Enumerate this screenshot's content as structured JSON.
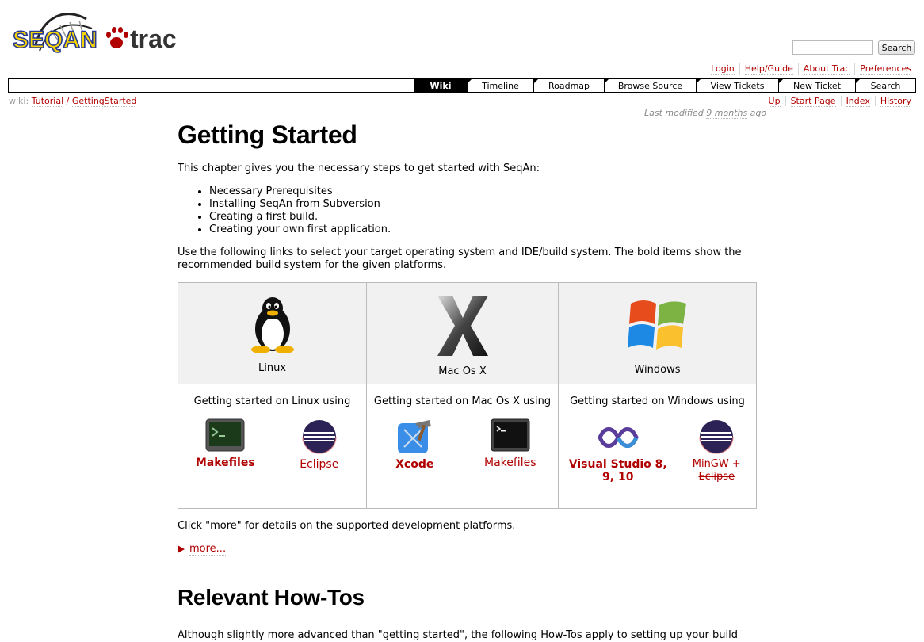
{
  "logo": {
    "project_text": "SEQAN",
    "trac_text": "trac",
    "icon": "paw-icon"
  },
  "search": {
    "button_label": "Search",
    "placeholder": ""
  },
  "metanav": [
    "Login",
    "Help/Guide",
    "About Trac",
    "Preferences"
  ],
  "mainnav": {
    "tabs": [
      {
        "label": "Wiki",
        "active": true
      },
      {
        "label": "Timeline",
        "active": false
      },
      {
        "label": "Roadmap",
        "active": false
      },
      {
        "label": "Browse Source",
        "active": false
      },
      {
        "label": "View Tickets",
        "active": false
      },
      {
        "label": "New Ticket",
        "active": false
      },
      {
        "label": "Search",
        "active": false
      }
    ]
  },
  "breadcrumb": {
    "prefix": "wiki:",
    "items": [
      "Tutorial",
      "/",
      "GettingStarted"
    ]
  },
  "ctxnav": [
    "Up",
    "Start Page",
    "Index",
    "History"
  ],
  "lastmod": {
    "prefix": "Last modified ",
    "age": "9 months",
    "suffix": " ago"
  },
  "page": {
    "title": "Getting Started",
    "intro": "This chapter gives you the necessary steps to get started with SeqAn:",
    "steps": [
      "Necessary Prerequisites",
      "Installing SeqAn from Subversion",
      "Creating a first build.",
      "Creating your own first application."
    ],
    "select_text": "Use the following links to select your target operating system and IDE/build system. The bold items show the recommended build system for the given platforms.",
    "platforms": [
      {
        "os": "Linux",
        "icon": "tux-penguin-icon",
        "intro": "Getting started on Linux using",
        "tools": [
          {
            "label": "Makefiles",
            "icon": "terminal-icon",
            "bold": true,
            "strike": false
          },
          {
            "label": "Eclipse",
            "icon": "eclipse-icon",
            "bold": false,
            "strike": false
          }
        ]
      },
      {
        "os": "Mac Os X",
        "icon": "mac-os-x-icon",
        "intro": "Getting started on Mac Os X using",
        "tools": [
          {
            "label": "Xcode",
            "icon": "xcode-icon",
            "bold": true,
            "strike": false
          },
          {
            "label": "Makefiles",
            "icon": "terminal-icon",
            "bold": false,
            "strike": false
          }
        ]
      },
      {
        "os": "Windows",
        "icon": "windows-logo-icon",
        "intro": "Getting started on Windows using",
        "tools": [
          {
            "label": "Visual Studio 8, 9, 10",
            "icon": "visual-studio-icon",
            "bold": true,
            "strike": false
          },
          {
            "label": "MinGW + Eclipse",
            "icon": "eclipse-icon",
            "bold": false,
            "strike": true
          }
        ]
      }
    ],
    "more_text": "Click \"more\" for details on the supported development platforms.",
    "more_link": "more...",
    "howto_title": "Relevant How-Tos",
    "howto_text": "Although slightly more advanced than \"getting started\", the following How-Tos apply to setting up your build"
  },
  "colors": {
    "link": "#b00000",
    "logo_yellow": "#f5d400",
    "logo_blue": "#2a3b8f"
  }
}
